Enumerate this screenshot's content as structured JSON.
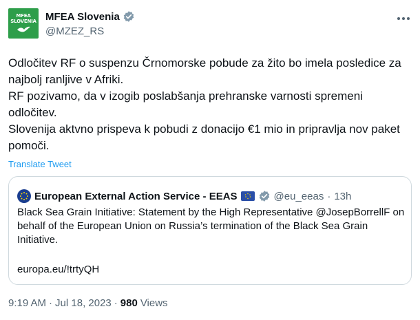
{
  "author": {
    "avatar_line1": "MFEA",
    "avatar_line2": "SLOVENIA",
    "display_name": "MFEA Slovenia",
    "handle": "@MZEZ_RS",
    "verified_color": "#829aab",
    "avatar_color": "#2e9e4a"
  },
  "tweet": {
    "paragraphs": [
      "Odločitev RF o suspenzu Črnomorske pobude za žito bo imela posledice za najbolj ranljive v Afriki.",
      "RF pozivamo, da v izogib poslabšanja prehranske varnosti spremeni odločitev.",
      "Slovenija aktvno prispeva k pobudi z donacijo €1 mio in pripravlja nov paket pomoči."
    ],
    "translate_label": "Translate Tweet"
  },
  "quote": {
    "display_name": "European External Action Service - EEAS",
    "handle": "@eu_eeas",
    "separator": "·",
    "time": "13h",
    "text": "Black Sea Grain Initiative: Statement by the High Representative @JosepBorrellF on behalf of the European Union on Russia’s termination of the Black Sea Grain Initiative.",
    "link": "europa.eu/!trtyQH",
    "verified_color": "#1d9bf0"
  },
  "meta": {
    "time": "9:19 AM",
    "separator1": "·",
    "date": "Jul 18, 2023",
    "separator2": "·",
    "views_count": "980",
    "views_label": "Views"
  },
  "colors": {
    "text": "#0f1419",
    "secondary": "#536471",
    "link": "#1d9bf0",
    "border": "#cfd9de"
  }
}
